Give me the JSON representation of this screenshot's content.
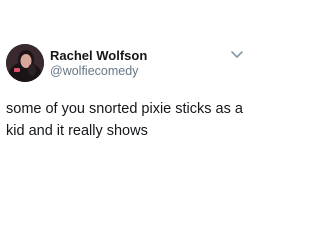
{
  "tweet": {
    "author": {
      "display_name": "Rachel Wolfson",
      "handle": "@wolfiecomedy",
      "avatar_icon": "profile-photo"
    },
    "menu_icon": "chevron-down-icon",
    "text": "some of you snorted pixie sticks as a kid and it really shows"
  }
}
